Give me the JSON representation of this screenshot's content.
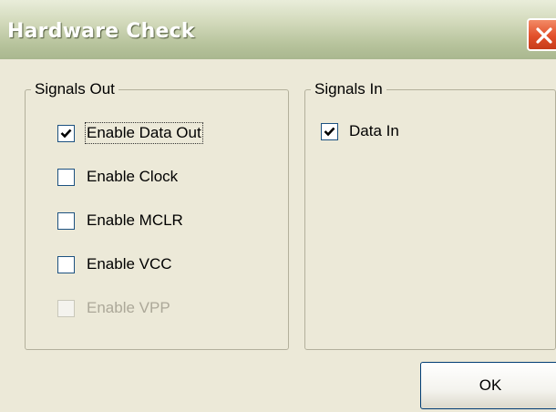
{
  "window": {
    "title": "Hardware Check",
    "close_icon": "close-icon"
  },
  "signals_out": {
    "legend": "Signals Out",
    "items": [
      {
        "label": "Enable Data Out",
        "checked": true,
        "enabled": true,
        "focused": true
      },
      {
        "label": "Enable Clock",
        "checked": false,
        "enabled": true
      },
      {
        "label": "Enable MCLR",
        "checked": false,
        "enabled": true
      },
      {
        "label": "Enable VCC",
        "checked": false,
        "enabled": true
      },
      {
        "label": "Enable VPP",
        "checked": false,
        "enabled": false
      }
    ]
  },
  "signals_in": {
    "legend": "Signals In",
    "items": [
      {
        "label": "Data In",
        "checked": true,
        "enabled": true
      }
    ]
  },
  "buttons": {
    "ok_label": "OK"
  },
  "colors": {
    "dialog_bg": "#ece9d8",
    "title_text": "#ffffff",
    "close_button": "#e2502a",
    "checkbox_border": "#1c5180",
    "disabled_text": "#aca899"
  }
}
